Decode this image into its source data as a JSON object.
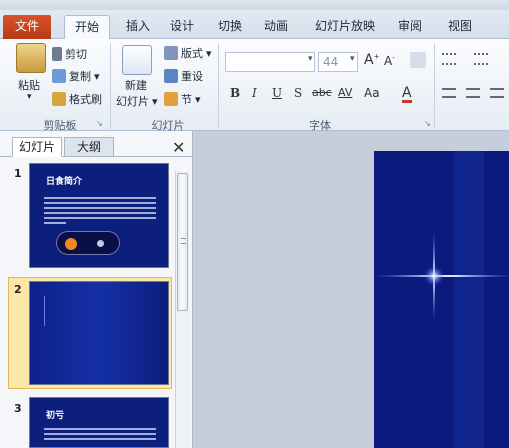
{
  "ribbon_tabs": [
    {
      "label": "文件"
    },
    {
      "label": "开始"
    },
    {
      "label": "插入"
    },
    {
      "label": "设计"
    },
    {
      "label": "切换"
    },
    {
      "label": "动画"
    },
    {
      "label": "幻灯片放映"
    },
    {
      "label": "审阅"
    },
    {
      "label": "视图"
    }
  ],
  "clipboard": {
    "paste": "粘贴",
    "cut": "剪切",
    "copy": "复制",
    "format_painter": "格式刷",
    "group_label": "剪贴板"
  },
  "slides_group": {
    "new_slide_line1": "新建",
    "new_slide_line2": "幻灯片",
    "layout": "版式",
    "reset": "重设",
    "section": "节",
    "group_label": "幻灯片"
  },
  "font_group": {
    "font_size": "44",
    "grow": "A",
    "shrink": "A",
    "bold": "B",
    "italic": "I",
    "underline": "U",
    "shadow": "S",
    "strike": "abc",
    "spacing": "AV",
    "case": "Aa",
    "color": "A",
    "group_label": "字体"
  },
  "pane": {
    "tab_slides": "幻灯片",
    "tab_outline": "大纲",
    "close": "✕"
  },
  "thumbnails": [
    {
      "number": "1",
      "title": "日食简介"
    },
    {
      "number": "2",
      "title": ""
    },
    {
      "number": "3",
      "title": "初亏"
    }
  ],
  "colors": {
    "file_tab": "#c8471f",
    "slide_background": "#0b1a7c",
    "selection": "#fbe7a6"
  }
}
